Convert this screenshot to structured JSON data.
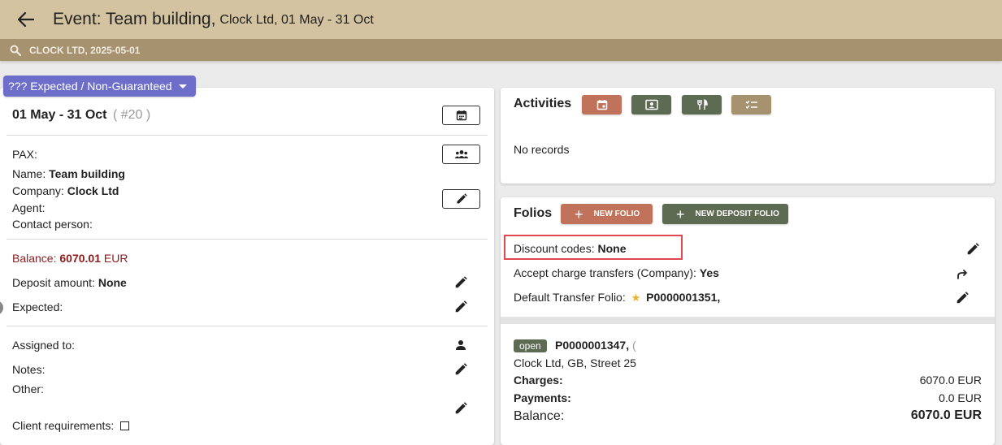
{
  "header": {
    "title": "Event: Team building,",
    "subtitle": "Clock Ltd, 01 May - 31 Oct",
    "search_text": "CLOCK LTD, 2025-05-01"
  },
  "status": {
    "label": "??? Expected / Non-Guaranteed",
    "color": "#6c6ec9"
  },
  "left": {
    "date_range": "01 May - 31 Oct",
    "number": "( #20 )",
    "pax_label": "PAX:",
    "name_label": "Name:",
    "name_value": "Team building",
    "company_label": "Company:",
    "company_value": "Clock Ltd",
    "agent_label": "Agent:",
    "contact_label": "Contact person:",
    "balance_label": "Balance:",
    "balance_value": "6070.01",
    "balance_currency": "EUR",
    "deposit_label": "Deposit amount:",
    "deposit_value": "None",
    "expected_label": "Expected:",
    "assigned_label": "Assigned to:",
    "notes_label": "Notes:",
    "other_label": "Other:",
    "client_req_label": "Client requirements:"
  },
  "activities": {
    "title": "Activities",
    "empty_text": "No records",
    "buttons": [
      {
        "icon": "calendar-event-icon",
        "color": "#c0735a"
      },
      {
        "icon": "contact-card-icon",
        "color": "#5e6b53"
      },
      {
        "icon": "restaurant-icon",
        "color": "#5e6b53"
      },
      {
        "icon": "checklist-icon",
        "color": "#a6926f"
      }
    ]
  },
  "folios": {
    "title": "Folios",
    "new_folio_label": "NEW FOLIO",
    "new_deposit_label": "NEW DEPOSIT FOLIO",
    "discount_label": "Discount codes:",
    "discount_value": "None",
    "accept_transfers_label": "Accept charge transfers (Company):",
    "accept_transfers_value": "Yes",
    "default_transfer_label": "Default Transfer Folio:",
    "default_transfer_value": "P0000001351,",
    "folio": {
      "status": "open",
      "number": "P0000001347,",
      "number_trailing": "(",
      "address": "Clock Ltd, GB, Street 25",
      "charges_label": "Charges:",
      "charges_value": "6070.0 EUR",
      "payments_label": "Payments:",
      "payments_value": "0.0 EUR",
      "balance_label": "Balance:",
      "balance_value": "6070.0 EUR"
    }
  },
  "colors": {
    "topbar": "#d3c3a0",
    "searchbar": "#a6926f",
    "balance_red": "#8b1c1c",
    "highlight": "#e0474e"
  }
}
